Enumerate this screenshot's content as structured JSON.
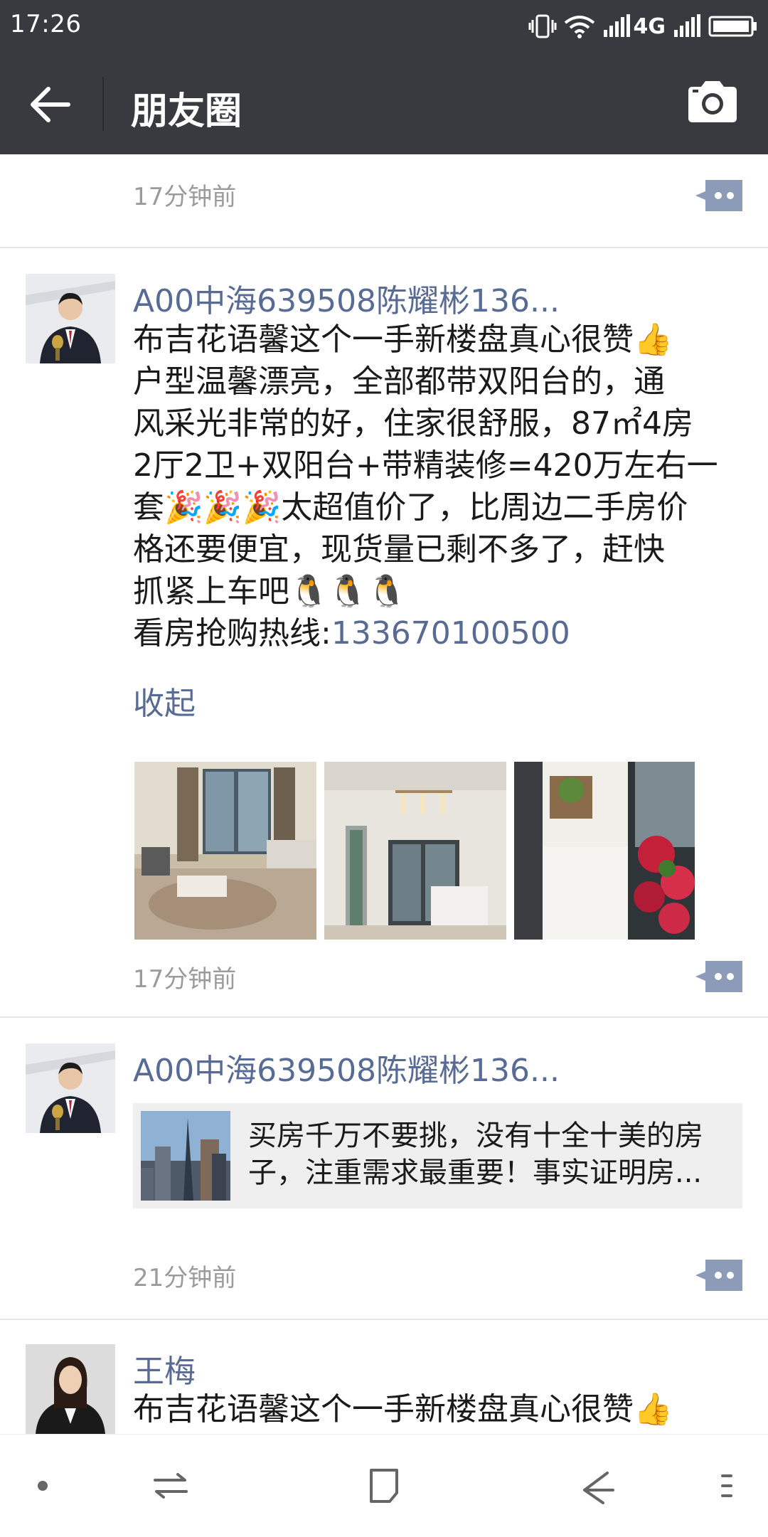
{
  "status_bar": {
    "time": "17:26",
    "network": "4G",
    "icons": [
      "vibrate-icon",
      "wifi-icon",
      "signal-icon",
      "signal-icon",
      "battery-icon"
    ]
  },
  "header": {
    "title": "朋友圈",
    "back_icon": "back-arrow-icon",
    "camera_icon": "camera-icon"
  },
  "colors": {
    "topbar": "#393a3f",
    "link": "#576b95",
    "time": "#9b9b9b",
    "shared_bg": "#efefef"
  },
  "feed": {
    "top_time": "17分钟前",
    "posts": [
      {
        "author": "A00中海639508陈耀彬136...",
        "text_lines": [
          "布吉花语馨这个一手新楼盘真心很赞👍",
          "户型温馨漂亮，全部都带双阳台的，通",
          "风采光非常的好，住家很舒服，87㎡4房",
          "2厅2卫+双阳台+带精装修=420万左右一",
          "套🎉🎉🎉太超值价了，比周边二手房价",
          "格还要便宜，现货量已剩不多了，赶快",
          "抓紧上车吧🐧🐧🐧"
        ],
        "hotline_label": "看房抢购热线:",
        "hotline_number": "133670100500",
        "collapse_label": "收起",
        "time": "17分钟前"
      },
      {
        "author": "A00中海639508陈耀彬136...",
        "shared_text": "买房千万不要挑，没有十全十美的房子，注重需求最重要！事实证明房...",
        "time": "21分钟前"
      },
      {
        "author": "王梅",
        "text_preview": "布吉花语馨这个一手新楼盘真心很赞👍"
      }
    ]
  },
  "bottom_nav": {
    "icons": [
      "dot-icon",
      "switch-icon",
      "square-icon",
      "back-icon",
      "menu-icon"
    ]
  }
}
